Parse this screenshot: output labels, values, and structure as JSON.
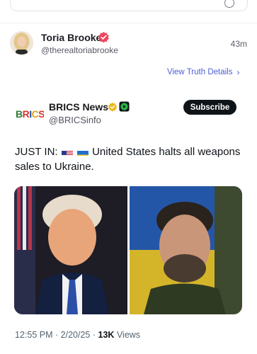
{
  "truth": {
    "author_name": "Toria Brooke",
    "author_handle": "@therealtoriabrooke",
    "time_ago": "43m",
    "view_details_label": "View Truth Details",
    "chevron": "›"
  },
  "embedded_post": {
    "author_name": "BRICS News",
    "author_handle": "@BRICSinfo",
    "logo_text": "BRICS",
    "subscribe_label": "Subscribe",
    "text_prefix": "JUST IN:",
    "text_body": "United States halts all weapons sales to Ukraine.",
    "flags": [
      "us-flag",
      "ukraine-flag"
    ],
    "time": "12:55 PM",
    "date": "2/20/25",
    "separator": "·",
    "views_count": "13K",
    "views_label": "Views"
  },
  "colors": {
    "link_blue": "#4d5ed6",
    "verified_red": "#f0445e",
    "badge_gold": "#e8b923",
    "badge_green": "#2cb34a",
    "subscribe_bg": "#0f1419"
  },
  "icons": {
    "search": "search-icon",
    "truth_verified": "verified-badge-icon",
    "x_verified": "gold-verified-icon",
    "affiliate": "affiliate-badge-icon"
  }
}
